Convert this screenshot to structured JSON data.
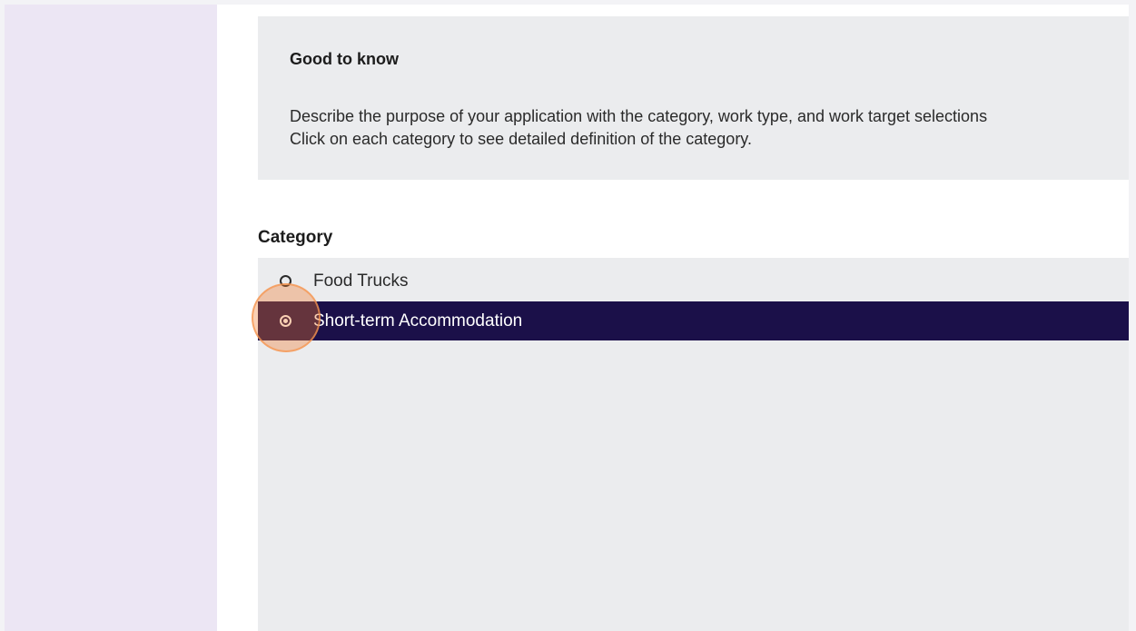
{
  "info": {
    "title": "Good to know",
    "line1": "Describe the purpose of your application with the category, work type, and work target selections",
    "line2": "Click on each category to see detailed definition of the category."
  },
  "category": {
    "label": "Category",
    "options": [
      {
        "label": "Food Trucks",
        "selected": false
      },
      {
        "label": "Short-term Accommodation",
        "selected": true
      }
    ]
  },
  "colors": {
    "selected_row": "#1b1049",
    "sidebar": "#ece6f4",
    "panel": "#ebecee"
  }
}
